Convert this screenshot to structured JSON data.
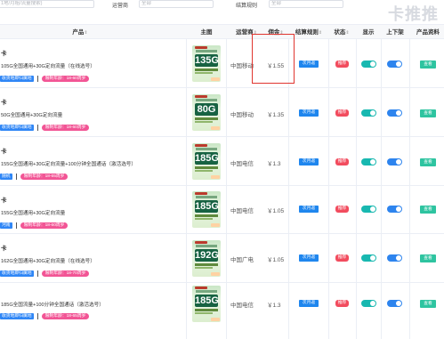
{
  "filters": {
    "search_placeholder": "1地/月租/流量搜索)",
    "operator_label": "运营商",
    "operator_value": "全部",
    "settle_label": "结算规则",
    "settle_value": "全部"
  },
  "watermark": "卡推推",
  "columns": {
    "product": "产品",
    "image": "主图",
    "operator": "运营商",
    "commission": "佣金",
    "settle": "结算规则",
    "status": "状态",
    "show": "显示",
    "listing": "上下架",
    "info": "产品资料"
  },
  "sort_glyph": "⇕",
  "rows": [
    {
      "name": "卡",
      "desc": "105G全国通用+30G定向流量（在线选号）",
      "tag": "收货地即归属地",
      "age": "限制年龄：18-60周岁",
      "thumb": "135G",
      "operator": "中国移动",
      "commission": "￥1.55",
      "settle": "次月返",
      "status": "推荐",
      "view": "查看"
    },
    {
      "name": "卡",
      "desc": "50G全国通用+30G定向流量",
      "tag": "收货地即归属地",
      "age": "限制年龄：18-60周岁",
      "thumb": "80G",
      "operator": "中国移动",
      "commission": "￥1.35",
      "settle": "次月返",
      "status": "推荐",
      "view": "查看"
    },
    {
      "name": "卡",
      "desc": "155G全国通用+30G定向流量+100分钟全国通话（激活选号）",
      "tag": "随机",
      "age": "限制年龄：18-65周岁",
      "thumb": "185G",
      "operator": "中国电信",
      "commission": "￥1.3",
      "settle": "次月返",
      "status": "推荐",
      "view": "查看"
    },
    {
      "name": "卡",
      "desc": "155G全国通用+30G定向流量",
      "tag": "河南",
      "age": "限制年龄：18-60周岁",
      "thumb": "185G",
      "operator": "中国电信",
      "commission": "￥1.05",
      "settle": "次月返",
      "status": "推荐",
      "view": "查看"
    },
    {
      "name": "卡",
      "desc": "162G全国通用+30G定向流量（在线选号）",
      "tag": "收货地即归属地",
      "age": "限制年龄：18-70周岁",
      "thumb": "192G",
      "operator": "中国广电",
      "commission": "￥1.05",
      "settle": "次月返",
      "status": "推荐",
      "view": "查看"
    },
    {
      "name": "",
      "desc": "185G全国流量+100分钟全国通话（激活选号）",
      "tag": "收货地即归属地",
      "age": "限制年龄：18-65周岁",
      "thumb": "185G",
      "operator": "中国电信",
      "commission": "￥1.3",
      "settle": "次月返",
      "status": "推荐",
      "view": "查看"
    }
  ],
  "colors": {
    "accent_blue": "#1f86ee",
    "toggle_teal": "#18b8b0",
    "status_red": "#f24c5e",
    "highlight_red": "#e0352f"
  }
}
